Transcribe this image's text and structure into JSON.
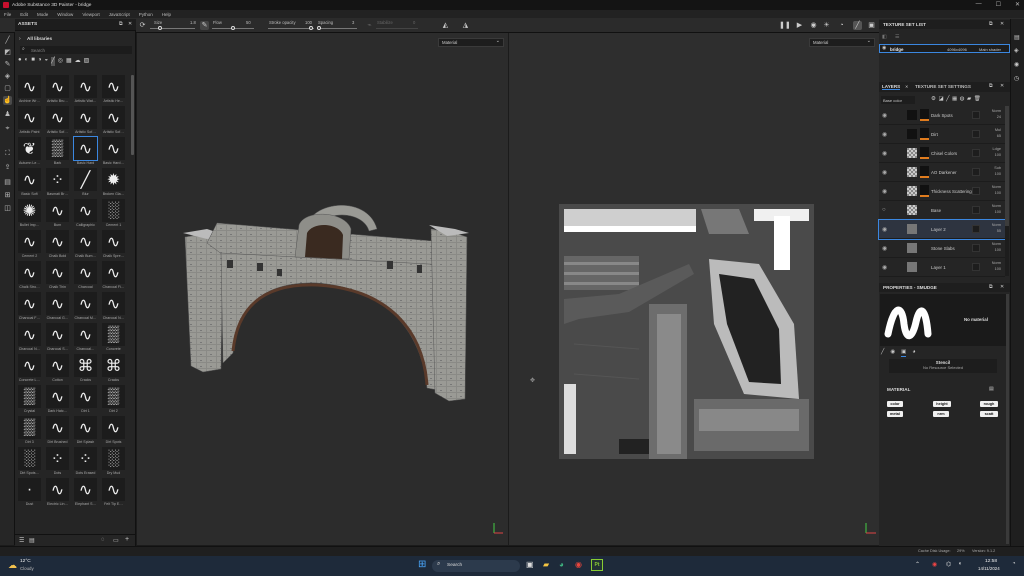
{
  "window": {
    "title": "Adobe Substance 3D Painter - bridge",
    "controls": [
      "—",
      "☐",
      "✕"
    ]
  },
  "menu": [
    "File",
    "Edit",
    "Mode",
    "Window",
    "Viewport",
    "JavaScript",
    "Python",
    "Help"
  ],
  "toolbar": {
    "size_label": "Size",
    "size_value": "1.8",
    "flow_label": "Flow",
    "flow_value": "50",
    "stroke_opacity_label": "Stroke opacity",
    "stroke_opacity_value": "100",
    "spacing_label": "Spacing",
    "spacing_value": "3",
    "stabilize_label": "Stabilize",
    "stabilize_value": "0"
  },
  "assets": {
    "title": "ASSETS",
    "library": "All libraries",
    "search_placeholder": "Search",
    "items": [
      "Archive Wr…",
      "Artistic Bru…",
      "Artistic Wat…",
      "Artistic He…",
      "Artistic Paint",
      "Artistic Sof…",
      "Artistic Sof…",
      "Artistic Sof…",
      "Autumn Le…",
      "Bark",
      "Basic Hard",
      "Basic Hard…",
      "Basic Soft",
      "Basmati Br…",
      "Blur",
      "Broken Gla…",
      "Bullet Imp…",
      "Burn",
      "Calligraphic",
      "Cement 1",
      "Cement 2",
      "Chalk Bold",
      "Chalk Bum…",
      "Chalk Spre…",
      "Chalk Stro…",
      "Chalk Thin",
      "Charcoal",
      "Charcoal Fi…",
      "Charcoal F…",
      "Charcoal G…",
      "Charcoal M…",
      "Charcoal N…",
      "Charcoal N…",
      "Charcoal S…",
      "Charcoal…",
      "Concrete",
      "Concrete L…",
      "Cotton",
      "Cracks",
      "Cracks",
      "Crystal",
      "Dark Hatc…",
      "Dirt 1",
      "Dirt 2",
      "Dirt 3",
      "Dirt Brushed",
      "Dirt Splash",
      "Dirt Spots",
      "Dirt Spots…",
      "Dots",
      "Dots Erased",
      "Dry Mud",
      "Dust",
      "Electric Lin…",
      "Elephant S…",
      "Felt Tip E…"
    ],
    "glyphs": [
      "∿",
      "∿",
      "∿",
      "∿",
      "∿",
      "∿",
      "∿",
      "∿",
      "❦",
      "▒",
      "∿",
      "∿",
      "∿",
      "⁘",
      "╱",
      "✹",
      "✺",
      "∿",
      "∿",
      "░",
      "∿",
      "∿",
      "∿",
      "∿",
      "∿",
      "∿",
      "∿",
      "∿",
      "∿",
      "∿",
      "∿",
      "∿",
      "∿",
      "∿",
      "∿",
      "▒",
      "∿",
      "∿",
      "⌘",
      "⌘",
      "▒",
      "∿",
      "∿",
      "▒",
      "▒",
      "∿",
      "∿",
      "∿",
      "░",
      "⁘",
      "⁘",
      "░",
      "·",
      "∿",
      "∿",
      "∿"
    ]
  },
  "viewport": {
    "left_channel": "Material",
    "right_channel": "Material"
  },
  "texture_set_list": {
    "title": "TEXTURE SET LIST",
    "set_name": "bridge",
    "resolution": "4096x4096",
    "shader": "Main shader"
  },
  "layers": {
    "tab1": "LAYERS",
    "tab2": "TEXTURE SET SETTINGS",
    "mode": "Base color",
    "rows": [
      {
        "name": "Dark Spots",
        "blend": "Norm",
        "opacity": "24"
      },
      {
        "name": "Dirt",
        "blend": "Mul",
        "opacity": "65"
      },
      {
        "name": "Chisel Colors",
        "blend": "Ldge",
        "opacity": "100"
      },
      {
        "name": "AO Darkener",
        "blend": "Sub",
        "opacity": "100"
      },
      {
        "name": "Thickness Scattering",
        "blend": "Norm",
        "opacity": "100"
      },
      {
        "name": "Base",
        "blend": "Norm",
        "opacity": "100"
      },
      {
        "name": "Layer 2",
        "blend": "Norm",
        "opacity": "55"
      },
      {
        "name": "Stone Slabs",
        "blend": "Norm",
        "opacity": "100"
      },
      {
        "name": "Layer 1",
        "blend": "Norm",
        "opacity": "100"
      }
    ]
  },
  "properties": {
    "title": "PROPERTIES - SMUDGE",
    "no_material": "No material",
    "stencil": "Stencil",
    "no_resource": "No Resource Selected",
    "material_title": "MATERIAL",
    "chips": [
      "color",
      "height",
      "rough",
      "metal",
      "nrm",
      "scatt"
    ]
  },
  "status": {
    "cache": "Cache Disk Usage:",
    "cache_value": "29%",
    "version": "Version: 9.1.2"
  },
  "taskbar": {
    "temp": "12°C",
    "weather": "Cloudy",
    "search": "Search",
    "time": "12:58",
    "date": "14/11/2024"
  }
}
